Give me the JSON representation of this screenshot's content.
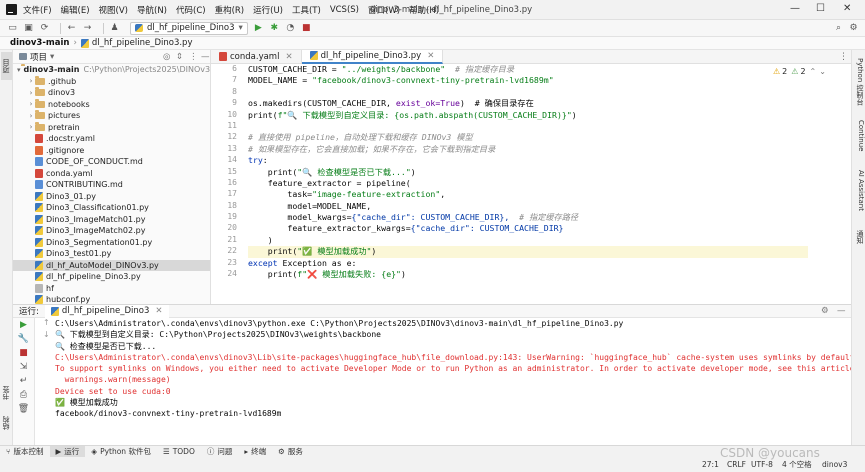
{
  "menubar": {
    "items": [
      "文件(F)",
      "编辑(E)",
      "视图(V)",
      "导航(N)",
      "代码(C)",
      "重构(R)",
      "运行(U)",
      "工具(T)",
      "VCS(S)",
      "窗口(W)",
      "帮助(H)"
    ],
    "title": "dinov3-main - dl_hf_pipeline_Dino3.py"
  },
  "toolbar": {
    "run_config": "dl_hf_pipeline_Dino3"
  },
  "breadcrumb": {
    "project": "dinov3-main",
    "file": "dl_hf_pipeline_Dino3.py"
  },
  "project_panel": {
    "title": "项目",
    "root": {
      "name": "dinov3-main",
      "path": "C:\\Python\\Projects2025\\DINOv3\\dino"
    },
    "items": [
      {
        "name": ".github",
        "type": "folder"
      },
      {
        "name": "dinov3",
        "type": "folder"
      },
      {
        "name": "notebooks",
        "type": "folder"
      },
      {
        "name": "pictures",
        "type": "folder"
      },
      {
        "name": "pretrain",
        "type": "folder"
      },
      {
        "name": ".docstr.yaml",
        "type": "yml"
      },
      {
        "name": ".gitignore",
        "type": "git"
      },
      {
        "name": "CODE_OF_CONDUCT.md",
        "type": "md"
      },
      {
        "name": "conda.yaml",
        "type": "yml"
      },
      {
        "name": "CONTRIBUTING.md",
        "type": "md"
      },
      {
        "name": "Dino3_01.py",
        "type": "py"
      },
      {
        "name": "Dino3_Classification01.py",
        "type": "py"
      },
      {
        "name": "Dino3_ImageMatch01.py",
        "type": "py"
      },
      {
        "name": "Dino3_ImageMatch02.py",
        "type": "py"
      },
      {
        "name": "Dino3_Segmentation01.py",
        "type": "py"
      },
      {
        "name": "Dino3_test01.py",
        "type": "py"
      },
      {
        "name": "dl_hf_AutoModel_DINOv3.py",
        "type": "py"
      },
      {
        "name": "dl_hf_pipeline_Dino3.py",
        "type": "py"
      },
      {
        "name": "hf",
        "type": "txt"
      },
      {
        "name": "hubconf.py",
        "type": "py"
      }
    ]
  },
  "editor_tabs": [
    {
      "label": "conda.yaml"
    },
    {
      "label": "dl_hf_pipeline_Dino3.py"
    }
  ],
  "inspection": {
    "warnings": "2",
    "weak": "2"
  },
  "code": {
    "line_numbers": [
      "6",
      "7",
      "8",
      "9",
      "10",
      "11",
      "12",
      "13",
      "14",
      "15",
      "16",
      "17",
      "18",
      "19",
      "20",
      "21",
      "22",
      "23",
      "24"
    ],
    "lines": [
      [
        "CUSTOM_CACHE_DIR = ",
        "\"../weights/backbone\"",
        "  # 指定缓存目录"
      ],
      [
        "MODEL_NAME = ",
        "\"facebook/dinov3-convnext-tiny-pretrain-lvd1689m\"",
        ""
      ],
      [
        "",
        "",
        ""
      ],
      [
        "os.makedirs(CUSTOM_CACHE_DIR, ",
        "exist_ok=True",
        ")  # 确保目录存在"
      ],
      [
        "print(",
        "f\"🔍 下载模型到自定义目录: {os.path.abspath(CUSTOM_CACHE_DIR)}\"",
        ")"
      ],
      [
        "",
        "",
        ""
      ],
      [
        "",
        "",
        "# 直接使用 pipeline，自动处理下载和缓存 DINOv3 模型"
      ],
      [
        "",
        "",
        "# 如果模型存在，它会直接加载；如果不存在，它会下载到指定目录"
      ],
      [
        "try",
        ":",
        ""
      ],
      [
        "    print(",
        "\"🔍 检查模型是否已下载...\"",
        ")"
      ],
      [
        "    feature_extractor = pipeline(",
        "",
        ""
      ],
      [
        "        task=",
        "\"image-feature-extraction\"",
        ","
      ],
      [
        "        model=MODEL_NAME,",
        "",
        ""
      ],
      [
        "        model_kwargs=",
        "{\"cache_dir\": CUSTOM_CACHE_DIR},",
        "  # 指定缓存路径"
      ],
      [
        "        feature_extractor_kwargs=",
        "{\"cache_dir\": CUSTOM_CACHE_DIR}",
        ""
      ],
      [
        "    )",
        "",
        ""
      ],
      [
        "    print(",
        "\"✅ 模型加载成功\"",
        ")"
      ],
      [
        "except ",
        "Exception as e",
        ":"
      ],
      [
        "    print(",
        "f\"❌ 模型加载失败: {e}\"",
        ")"
      ]
    ]
  },
  "run_panel": {
    "label": "运行:",
    "tab": "dl_hf_pipeline_Dino3",
    "console": [
      {
        "text": "C:\\Users\\Administrator\\.conda\\envs\\dinov3\\python.exe C:\\Python\\Projects2025\\DINOv3\\dinov3-main\\dl_hf_pipeline_Dino3.py",
        "kind": "normal"
      },
      {
        "text": "🔍 下载模型到自定义目录: C:\\Python\\Projects2025\\DINOv3\\weights\\backbone",
        "kind": "normal"
      },
      {
        "text": "🔍 检查模型是否已下载...",
        "kind": "normal"
      },
      {
        "text": "C:\\Users\\Administrator\\.conda\\envs\\dinov3\\Lib\\site-packages\\huggingface_hub\\file_download.py:143: UserWarning: `huggingface_hub` cache-system uses symlinks by default to effici",
        "kind": "err"
      },
      {
        "text": "To support symlinks on Windows, you either need to activate Developer Mode or to run Python as an administrator. In order to activate developer mode, see this article: https://",
        "kind": "err"
      },
      {
        "text": "  warnings.warn(message)",
        "kind": "err"
      },
      {
        "text": "Device set to use cuda:0",
        "kind": "err"
      },
      {
        "text": "✅ 模型加载成功",
        "kind": "normal"
      },
      {
        "text": "facebook/dinov3-convnext-tiny-pretrain-lvd1689m",
        "kind": "normal"
      }
    ]
  },
  "bottom_tabs": [
    "版本控制",
    "运行",
    "Python 软件包",
    "TODO",
    "问题",
    "终端",
    "服务"
  ],
  "left_vtabs": [
    "项目",
    "书签",
    "结构"
  ],
  "right_vtabs": [
    "Python 控制台",
    "Continue",
    "AI Assistant",
    "通知"
  ],
  "status": {
    "position": "27:1",
    "line_sep": "CRLF",
    "encoding": "UTF-8",
    "indent": "4 个空格",
    "interpreter": "dinov3"
  },
  "watermark": "CSDN @youcans"
}
